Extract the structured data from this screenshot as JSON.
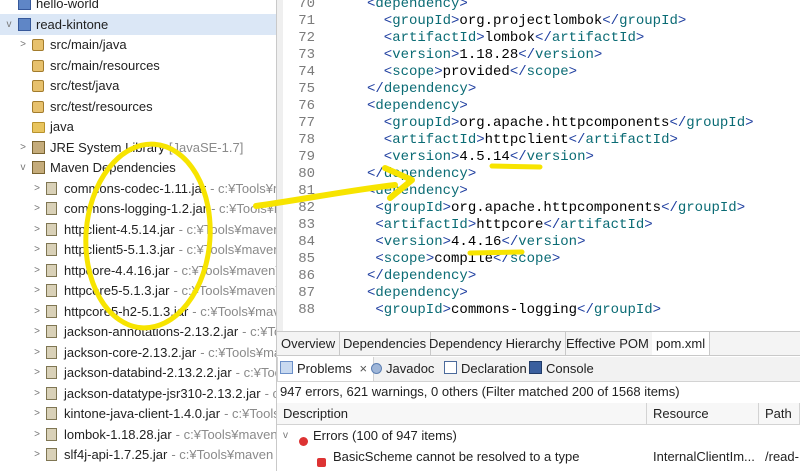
{
  "tree": {
    "items": [
      {
        "label": "hello-world",
        "decoration": "",
        "indent": 0,
        "toggle": "",
        "icon": "proj"
      },
      {
        "label": "read-kintone",
        "decoration": "",
        "indent": 0,
        "toggle": "v",
        "icon": "proj"
      },
      {
        "label": "src/main/java",
        "decoration": "",
        "indent": 1,
        "toggle": ">",
        "icon": "pkg"
      },
      {
        "label": "src/main/resources",
        "decoration": "",
        "indent": 1,
        "toggle": "",
        "icon": "pkg"
      },
      {
        "label": "src/test/java",
        "decoration": "",
        "indent": 1,
        "toggle": "",
        "icon": "pkg"
      },
      {
        "label": "src/test/resources",
        "decoration": "",
        "indent": 1,
        "toggle": "",
        "icon": "pkg"
      },
      {
        "label": "java",
        "decoration": "",
        "indent": 1,
        "toggle": "",
        "icon": "folder"
      },
      {
        "label": "JRE System Library",
        "decoration": "[JavaSE-1.7]",
        "indent": 1,
        "toggle": ">",
        "icon": "lib"
      },
      {
        "label": "Maven Dependencies",
        "decoration": "",
        "indent": 1,
        "toggle": "v",
        "icon": "lib"
      },
      {
        "label": "commons-codec-1.11.jar",
        "decoration": "- c:¥Tools¥m",
        "indent": 2,
        "toggle": ">",
        "icon": "jar"
      },
      {
        "label": "commons-logging-1.2.jar",
        "decoration": "- c:¥Tools¥m",
        "indent": 2,
        "toggle": ">",
        "icon": "jar"
      },
      {
        "label": "httpclient-4.5.14.jar",
        "decoration": "- c:¥Tools¥maven¥",
        "indent": 2,
        "toggle": ">",
        "icon": "jar"
      },
      {
        "label": "httpclient5-5.1.3.jar",
        "decoration": "- c:¥Tools¥maven¥",
        "indent": 2,
        "toggle": ">",
        "icon": "jar"
      },
      {
        "label": "httpcore-4.4.16.jar",
        "decoration": "- c:¥Tools¥maven¥r",
        "indent": 2,
        "toggle": ">",
        "icon": "jar"
      },
      {
        "label": "httpcore5-5.1.3.jar",
        "decoration": "- c:¥Tools¥maven¥r",
        "indent": 2,
        "toggle": ">",
        "icon": "jar"
      },
      {
        "label": "httpcore5-h2-5.1.3.jar",
        "decoration": "- c:¥Tools¥maven¥r",
        "indent": 2,
        "toggle": ">",
        "icon": "jar"
      },
      {
        "label": "jackson-annotations-2.13.2.jar",
        "decoration": "- c:¥Toc",
        "indent": 2,
        "toggle": ">",
        "icon": "jar"
      },
      {
        "label": "jackson-core-2.13.2.jar",
        "decoration": "- c:¥Tools¥mav",
        "indent": 2,
        "toggle": ">",
        "icon": "jar"
      },
      {
        "label": "jackson-databind-2.13.2.2.jar",
        "decoration": "- c:¥Tool",
        "indent": 2,
        "toggle": ">",
        "icon": "jar"
      },
      {
        "label": "jackson-datatype-jsr310-2.13.2.jar",
        "decoration": "- c:¥",
        "indent": 2,
        "toggle": ">",
        "icon": "jar"
      },
      {
        "label": "kintone-java-client-1.4.0.jar",
        "decoration": "- c:¥Tools",
        "indent": 2,
        "toggle": ">",
        "icon": "jar"
      },
      {
        "label": "lombok-1.18.28.jar",
        "decoration": "- c:¥Tools¥maven",
        "indent": 2,
        "toggle": ">",
        "icon": "jar"
      },
      {
        "label": "slf4j-api-1.7.25.jar",
        "decoration": "- c:¥Tools¥maven",
        "indent": 2,
        "toggle": ">",
        "icon": "jar"
      }
    ]
  },
  "editor": {
    "lines": [
      {
        "n": "70",
        "indent": 5,
        "parts": [
          [
            "tg",
            "<"
          ],
          [
            "tn",
            "dependency"
          ],
          [
            "tg",
            ">"
          ]
        ]
      },
      {
        "n": "71",
        "indent": 7,
        "parts": [
          [
            "tg",
            "<"
          ],
          [
            "tn",
            "groupId"
          ],
          [
            "tg",
            ">"
          ],
          [
            "tx",
            "org.projectlombok"
          ],
          [
            "tg",
            "</"
          ],
          [
            "tn",
            "groupId"
          ],
          [
            "tg",
            ">"
          ]
        ]
      },
      {
        "n": "72",
        "indent": 7,
        "parts": [
          [
            "tg",
            "<"
          ],
          [
            "tn",
            "artifactId"
          ],
          [
            "tg",
            ">"
          ],
          [
            "tx",
            "lombok"
          ],
          [
            "tg",
            "</"
          ],
          [
            "tn",
            "artifactId"
          ],
          [
            "tg",
            ">"
          ]
        ]
      },
      {
        "n": "73",
        "indent": 7,
        "parts": [
          [
            "tg",
            "<"
          ],
          [
            "tn",
            "version"
          ],
          [
            "tg",
            ">"
          ],
          [
            "tx",
            "1.18.28"
          ],
          [
            "tg",
            "</"
          ],
          [
            "tn",
            "version"
          ],
          [
            "tg",
            ">"
          ]
        ]
      },
      {
        "n": "74",
        "indent": 7,
        "parts": [
          [
            "tg",
            "<"
          ],
          [
            "tn",
            "scope"
          ],
          [
            "tg",
            ">"
          ],
          [
            "tx",
            "provided"
          ],
          [
            "tg",
            "</"
          ],
          [
            "tn",
            "scope"
          ],
          [
            "tg",
            ">"
          ]
        ]
      },
      {
        "n": "75",
        "indent": 5,
        "parts": [
          [
            "tg",
            "</"
          ],
          [
            "tn",
            "dependency"
          ],
          [
            "tg",
            ">"
          ]
        ]
      },
      {
        "n": "76",
        "indent": 5,
        "parts": [
          [
            "tg",
            "<"
          ],
          [
            "tn",
            "dependency"
          ],
          [
            "tg",
            ">"
          ]
        ]
      },
      {
        "n": "77",
        "indent": 7,
        "parts": [
          [
            "tg",
            "<"
          ],
          [
            "tn",
            "groupId"
          ],
          [
            "tg",
            ">"
          ],
          [
            "tx",
            "org.apache.httpcomponents"
          ],
          [
            "tg",
            "</"
          ],
          [
            "tn",
            "groupId"
          ],
          [
            "tg",
            ">"
          ]
        ]
      },
      {
        "n": "78",
        "indent": 7,
        "parts": [
          [
            "tg",
            "<"
          ],
          [
            "tn",
            "artifactId"
          ],
          [
            "tg",
            ">"
          ],
          [
            "tx",
            "httpclient"
          ],
          [
            "tg",
            "</"
          ],
          [
            "tn",
            "artifactId"
          ],
          [
            "tg",
            ">"
          ]
        ]
      },
      {
        "n": "79",
        "indent": 7,
        "parts": [
          [
            "tg",
            "<"
          ],
          [
            "tn",
            "version"
          ],
          [
            "tg",
            ">"
          ],
          [
            "tx",
            "4.5.14"
          ],
          [
            "tg",
            "</"
          ],
          [
            "tn",
            "version"
          ],
          [
            "tg",
            ">"
          ]
        ]
      },
      {
        "n": "80",
        "indent": 5,
        "parts": [
          [
            "tg",
            "</"
          ],
          [
            "tn",
            "dependency"
          ],
          [
            "tg",
            ">"
          ]
        ]
      },
      {
        "n": "81",
        "indent": 5,
        "parts": [
          [
            "tg",
            "<"
          ],
          [
            "tn",
            "dependency"
          ],
          [
            "tg",
            ">"
          ]
        ]
      },
      {
        "n": "82",
        "indent": 6,
        "parts": [
          [
            "tg",
            "<"
          ],
          [
            "tn",
            "groupId"
          ],
          [
            "tg",
            ">"
          ],
          [
            "tx",
            "org.apache.httpcomponents"
          ],
          [
            "tg",
            "</"
          ],
          [
            "tn",
            "groupId"
          ],
          [
            "tg",
            ">"
          ]
        ]
      },
      {
        "n": "83",
        "indent": 6,
        "parts": [
          [
            "tg",
            "<"
          ],
          [
            "tn",
            "artifactId"
          ],
          [
            "tg",
            ">"
          ],
          [
            "tx",
            "httpcore"
          ],
          [
            "tg",
            "</"
          ],
          [
            "tn",
            "artifactId"
          ],
          [
            "tg",
            ">"
          ]
        ]
      },
      {
        "n": "84",
        "indent": 6,
        "parts": [
          [
            "tg",
            "<"
          ],
          [
            "tn",
            "version"
          ],
          [
            "tg",
            ">"
          ],
          [
            "tx",
            "4.4.16"
          ],
          [
            "tg",
            "</"
          ],
          [
            "tn",
            "version"
          ],
          [
            "tg",
            ">"
          ]
        ]
      },
      {
        "n": "85",
        "indent": 6,
        "parts": [
          [
            "tg",
            "<"
          ],
          [
            "tn",
            "scope"
          ],
          [
            "tg",
            ">"
          ],
          [
            "tx",
            "compile"
          ],
          [
            "tg",
            "</"
          ],
          [
            "tn",
            "scope"
          ],
          [
            "tg",
            ">"
          ]
        ]
      },
      {
        "n": "86",
        "indent": 5,
        "parts": [
          [
            "tg",
            "</"
          ],
          [
            "tn",
            "dependency"
          ],
          [
            "tg",
            ">"
          ]
        ]
      },
      {
        "n": "87",
        "indent": 5,
        "parts": [
          [
            "tg",
            "<"
          ],
          [
            "tn",
            "dependency"
          ],
          [
            "tg",
            ">"
          ]
        ]
      },
      {
        "n": "88",
        "indent": 6,
        "parts": [
          [
            "tg",
            "<"
          ],
          [
            "tn",
            "groupId"
          ],
          [
            "tg",
            ">"
          ],
          [
            "tx",
            "commons-logging"
          ],
          [
            "tg",
            "</"
          ],
          [
            "tn",
            "groupId"
          ],
          [
            "tg",
            ">"
          ]
        ]
      }
    ]
  },
  "pom_tabs": [
    "Overview",
    "Dependencies",
    "Dependency Hierarchy",
    "Effective POM",
    "pom.xml"
  ],
  "view_tabs": {
    "problems": "Problems",
    "problems_close": "×",
    "javadoc": "Javadoc",
    "declaration": "Declaration",
    "console": "Console"
  },
  "status_line": "947 errors, 621 warnings, 0 others (Filter matched 200 of 1568 items)",
  "problems_table": {
    "headers": {
      "description": "Description",
      "resource": "Resource",
      "path": "Path"
    },
    "group": {
      "toggle": "v",
      "label": "Errors (100 of 947 items)"
    },
    "rows": [
      {
        "description": "BasicScheme cannot be resolved to a type",
        "resource": "InternalClientIm...",
        "path": "/read-"
      }
    ]
  },
  "colors": {
    "annotation": "#f7e400",
    "tag": "#1f3fa0",
    "tagname": "#0a6b74",
    "selection": "#dbe7f6"
  }
}
